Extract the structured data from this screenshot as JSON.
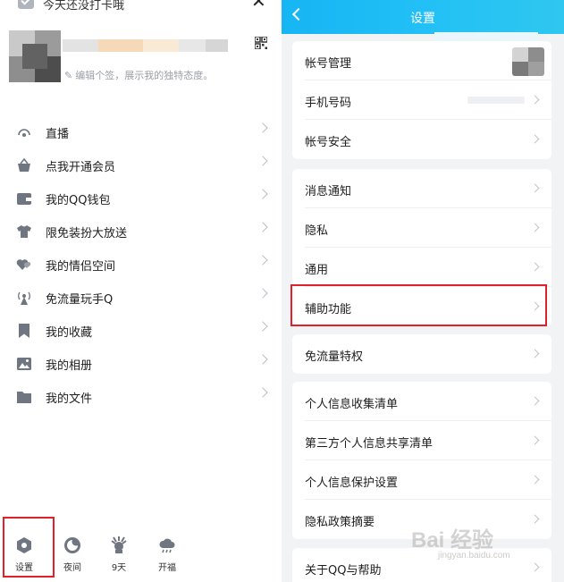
{
  "left": {
    "top_text": "今天还没打卡哦",
    "signature": "编辑个签，展示我的独特态度。",
    "menu": [
      {
        "label": "直播",
        "icon": "live-icon"
      },
      {
        "label": "点我开通会员",
        "icon": "crown-basket-icon"
      },
      {
        "label": "我的QQ钱包",
        "icon": "wallet-icon"
      },
      {
        "label": "限免装扮大放送",
        "icon": "tshirt-icon"
      },
      {
        "label": "我的情侣空间",
        "icon": "couple-hearts-icon"
      },
      {
        "label": "免流量玩手Q",
        "icon": "antenna-icon"
      },
      {
        "label": "我的收藏",
        "icon": "bookmark-icon"
      },
      {
        "label": "我的相册",
        "icon": "photo-icon"
      },
      {
        "label": "我的文件",
        "icon": "folder-icon"
      }
    ],
    "bottom": [
      {
        "label": "设置",
        "icon": "settings-icon"
      },
      {
        "label": "夜间",
        "icon": "moon-icon"
      },
      {
        "label": "9天",
        "icon": "weather-sun-icon"
      },
      {
        "label": "开福",
        "icon": "cloud-icon"
      }
    ]
  },
  "right": {
    "title": "设置",
    "groups": [
      [
        {
          "label": "帐号管理"
        },
        {
          "label": "手机号码"
        },
        {
          "label": "帐号安全"
        }
      ],
      [
        {
          "label": "消息通知"
        },
        {
          "label": "隐私"
        },
        {
          "label": "通用"
        },
        {
          "label": "辅助功能"
        }
      ],
      [
        {
          "label": "免流量特权"
        }
      ],
      [
        {
          "label": "个人信息收集清单"
        },
        {
          "label": "第三方个人信息共享清单"
        },
        {
          "label": "个人信息保护设置"
        },
        {
          "label": "隐私政策摘要"
        }
      ],
      [
        {
          "label": "关于QQ与帮助"
        }
      ]
    ]
  },
  "watermark": {
    "main": "Bai 经验",
    "sub": "jingyan.baidu.com"
  },
  "colors": {
    "header": "#18b7f5",
    "highlight": "#e0202b",
    "icon": "#6f7681"
  }
}
